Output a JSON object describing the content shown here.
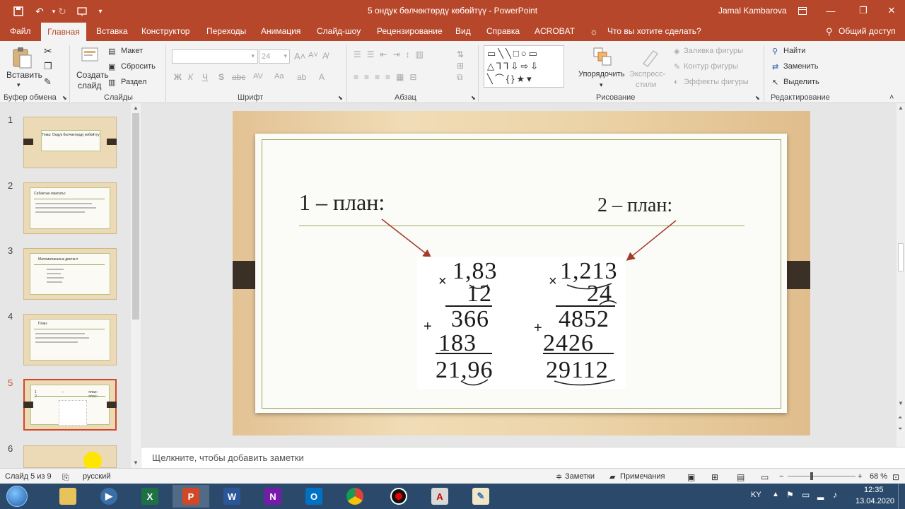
{
  "titlebar": {
    "doc_title": "5 ондук бөлчөктөрдү көбөйтүү - PowerPoint",
    "user": "Jamal Kambarova"
  },
  "tabs": [
    "Файл",
    "Главная",
    "Вставка",
    "Конструктор",
    "Переходы",
    "Анимация",
    "Слайд-шоу",
    "Рецензирование",
    "Вид",
    "Справка",
    "ACROBAT"
  ],
  "tell_me": "Что вы хотите сделать?",
  "share": "Общий доступ",
  "ribbon": {
    "clipboard": {
      "paste": "Вставить",
      "label": "Буфер обмена"
    },
    "slides": {
      "new_slide_1": "Создать",
      "new_slide_2": "слайд",
      "layout": "Макет",
      "reset": "Сбросить",
      "section": "Раздел",
      "label": "Слайды"
    },
    "font": {
      "size": "24",
      "bold": "Ж",
      "italic": "К",
      "underline": "Ч",
      "strike": "S",
      "label": "Шрифт"
    },
    "paragraph": {
      "label": "Абзац"
    },
    "drawing": {
      "arrange": "Упорядочить",
      "styles_1": "Экспресс-",
      "styles_2": "стили",
      "fill": "Заливка фигуры",
      "outline": "Контур фигуры",
      "effects": "Эффекты фигуры",
      "label": "Рисование"
    },
    "editing": {
      "find": "Найти",
      "replace": "Заменить",
      "select": "Выделить",
      "label": "Редактирование"
    }
  },
  "thumbnails": [
    {
      "num": "1",
      "title": "Тема: Ондук бөлчөктөрдү көбөйтүү"
    },
    {
      "num": "2",
      "title": "Сабактын максаты:"
    },
    {
      "num": "3",
      "title": "Математикалык диктант"
    },
    {
      "num": "4",
      "title": "План:"
    },
    {
      "num": "5",
      "title": "1 – план: 2 – план:"
    },
    {
      "num": "6",
      "title": ""
    }
  ],
  "slide": {
    "plan1": "1 – план:",
    "plan2": "2 – план:",
    "calc1": {
      "op1": "1,83",
      "op2": "12",
      "p1": "366",
      "p2": "183",
      "result": "21,96"
    },
    "calc2": {
      "op1": "1,213",
      "op2": "24",
      "p1": "4852",
      "p2": "2426",
      "result": "29112"
    }
  },
  "notes_placeholder": "Щелкните, чтобы добавить заметки",
  "status": {
    "slide_info": "Слайд 5 из 9",
    "language": "русский",
    "notes": "Заметки",
    "comments": "Примечания",
    "zoom": "68 %"
  },
  "tray": {
    "lang": "KY",
    "time": "12:35",
    "date": "13.04.2020"
  }
}
